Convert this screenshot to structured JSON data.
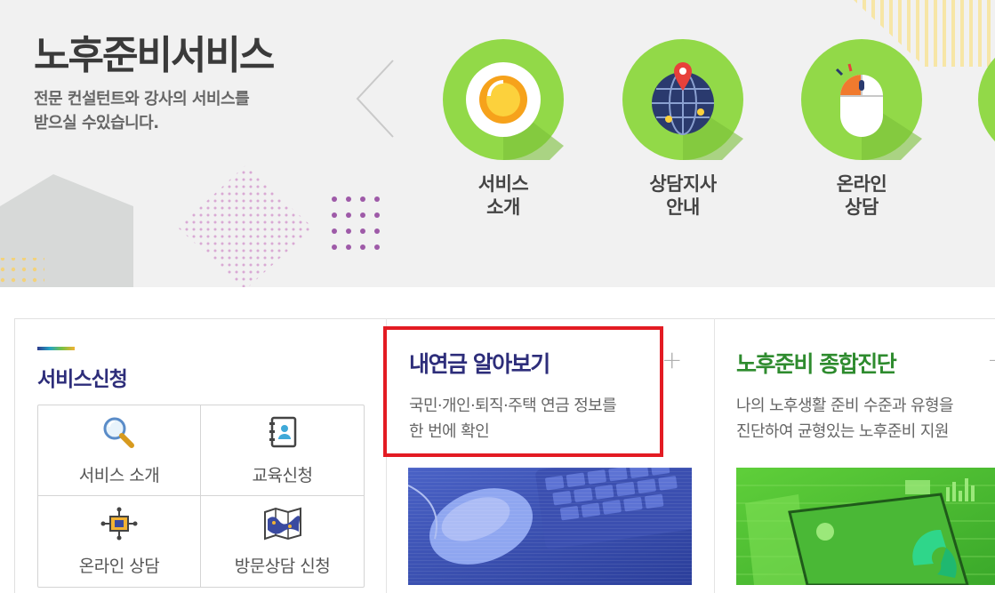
{
  "hero": {
    "title": "노후준비서비스",
    "desc_line1": "전문 컨설턴트와 강사의 서비스를",
    "desc_line2": "받으실 수있습니다.",
    "services": [
      {
        "line1": "서비스",
        "line2": "소개",
        "icon": "coffee-cup-icon"
      },
      {
        "line1": "상담지사",
        "line2": "안내",
        "icon": "globe-pin-icon"
      },
      {
        "line1": "온라인",
        "line2": "상담",
        "icon": "mouse-icon"
      }
    ]
  },
  "apply": {
    "title": "서비스신청",
    "items": [
      {
        "label": "서비스 소개",
        "icon": "magnifier-icon"
      },
      {
        "label": "교육신청",
        "icon": "address-book-icon"
      },
      {
        "label": "온라인 상담",
        "icon": "network-icon"
      },
      {
        "label": "방문상담 신청",
        "icon": "map-icon"
      }
    ]
  },
  "pension_card": {
    "title": "내연금 알아보기",
    "desc_line1": "국민·개인·퇴직·주택 연금 정보를",
    "desc_line2": "한 번에 확인",
    "plus": "+",
    "title_color": "#2d2d7a"
  },
  "diagnosis_card": {
    "title": "노후준비 종합진단",
    "desc_line1": "나의 노후생활 준비 수준과 유형을",
    "desc_line2": "진단하여 균형있는 노후준비 지원",
    "plus": "+",
    "title_color": "#2e8b2e"
  },
  "colors": {
    "circle_green": "#92d948",
    "highlight_red": "#e31b23",
    "navy": "#2d2d7a"
  }
}
